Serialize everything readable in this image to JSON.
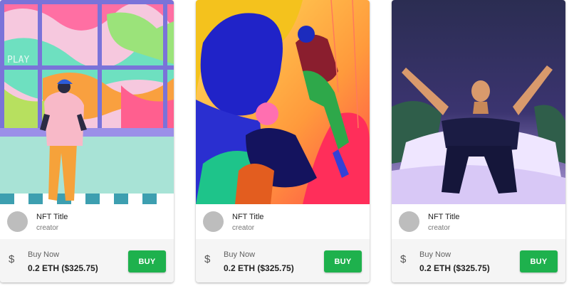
{
  "cards": [
    {
      "title": "NFT Title",
      "creator": "creator",
      "buy_label": "Buy Now",
      "price": "0.2 ETH ($325.75)",
      "button": "BUY",
      "art_text": "PLAY"
    },
    {
      "title": "NFT Title",
      "creator": "creator",
      "buy_label": "Buy Now",
      "price": "0.2 ETH ($325.75)",
      "button": "BUY"
    },
    {
      "title": "NFT Title",
      "creator": "creator",
      "buy_label": "Buy Now",
      "price": "0.2 ETH ($325.75)",
      "button": "BUY"
    }
  ],
  "icons": {
    "currency": "dollar-icon",
    "currency_glyph": "$"
  },
  "colors": {
    "buy_button": "#1eb14d",
    "avatar": "#bdbdbd",
    "footer_bg": "#f5f5f5"
  }
}
